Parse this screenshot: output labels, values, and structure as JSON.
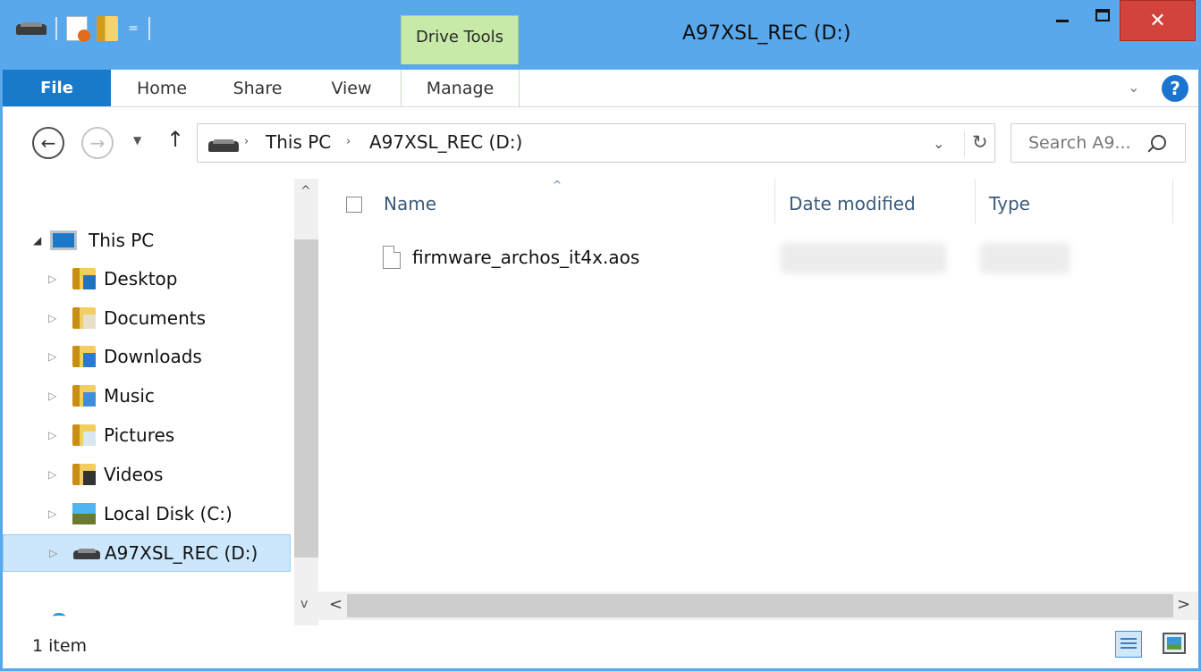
{
  "window": {
    "title": "A97XSL_REC (D:)",
    "contextual_tab": "Drive Tools",
    "close_label": "✕",
    "accent_color": "#5aa8ec",
    "close_color": "#d2433b"
  },
  "quick_access": {
    "icons": [
      "drive-icon",
      "properties-icon",
      "new-folder-icon",
      "customize-dropdown-icon"
    ],
    "dropdown_glyph": "="
  },
  "ribbon": {
    "tabs": [
      {
        "label": "File",
        "active": true
      },
      {
        "label": "Home"
      },
      {
        "label": "Share"
      },
      {
        "label": "View"
      },
      {
        "label": "Manage"
      }
    ],
    "expand_glyph": "⌄",
    "help_glyph": "?"
  },
  "navigation": {
    "back_glyph": "←",
    "forward_glyph": "→",
    "recent_glyph": "▼",
    "up_glyph": "↑",
    "breadcrumbs": [
      "This PC",
      "A97XSL_REC (D:)"
    ],
    "breadcrumb_separator": "›",
    "dropdown_glyph": "⌄",
    "refresh_glyph": "↻",
    "search_placeholder": "Search A9..."
  },
  "tree": {
    "root": "This PC",
    "items": [
      {
        "label": "Desktop",
        "icon": "desktop-folder-icon"
      },
      {
        "label": "Documents",
        "icon": "documents-folder-icon"
      },
      {
        "label": "Downloads",
        "icon": "downloads-folder-icon"
      },
      {
        "label": "Music",
        "icon": "music-folder-icon"
      },
      {
        "label": "Pictures",
        "icon": "pictures-folder-icon"
      },
      {
        "label": "Videos",
        "icon": "videos-folder-icon"
      },
      {
        "label": "Local Disk (C:)",
        "icon": "local-disk-icon"
      },
      {
        "label": "A97XSL_REC (D:)",
        "icon": "removable-drive-icon",
        "selected": true
      }
    ],
    "expander_glyph": "▷",
    "expanded_glyph": "◢",
    "scroll_up": "^",
    "scroll_down": "v"
  },
  "file_list": {
    "columns": [
      "Name",
      "Date modified",
      "Type"
    ],
    "sort_glyph": "^",
    "rows": [
      {
        "name": "firmware_archos_it4x.aos",
        "date_modified": "",
        "type": ""
      }
    ],
    "scroll_left": "<",
    "scroll_right": ">"
  },
  "status": {
    "item_count": "1 item"
  }
}
